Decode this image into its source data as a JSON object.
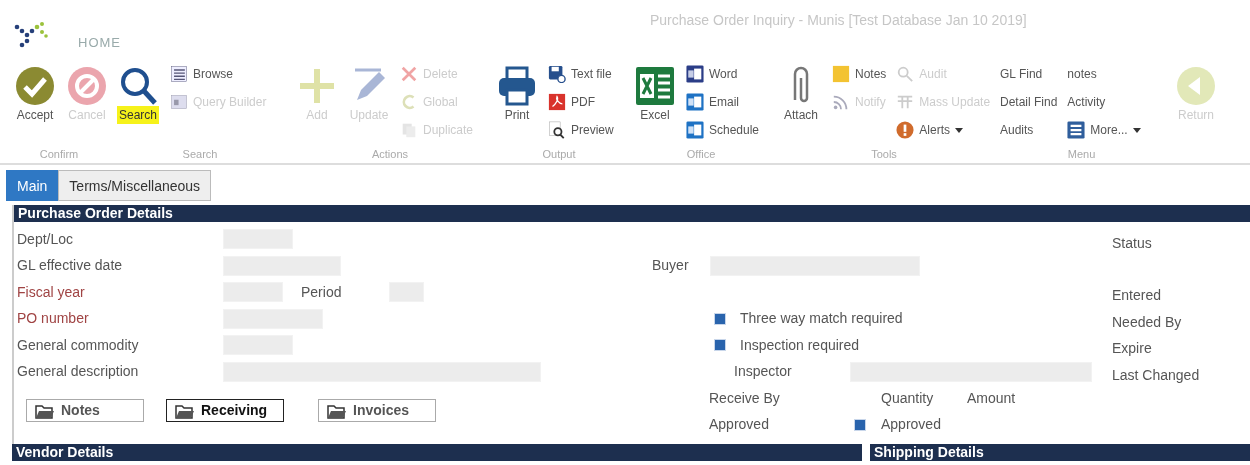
{
  "window": {
    "title": "Purchase Order Inquiry - Munis [Test Database Jan 10 2019]"
  },
  "ribbon": {
    "tab": "HOME",
    "groups": [
      {
        "label": "Confirm",
        "columns": [
          {
            "kind": "large",
            "items": [
              {
                "label": "Accept",
                "disabled": false
              }
            ]
          },
          {
            "kind": "large",
            "items": [
              {
                "label": "Cancel",
                "disabled": true
              }
            ]
          }
        ]
      },
      {
        "label": "Search",
        "columns": [
          {
            "kind": "large",
            "items": [
              {
                "label": "Search",
                "disabled": false,
                "highlighted": true
              }
            ]
          },
          {
            "kind": "small",
            "items": [
              {
                "label": "Browse",
                "disabled": false
              },
              {
                "label": "Query Builder",
                "disabled": true
              }
            ]
          }
        ]
      },
      {
        "label": "Actions",
        "columns": [
          {
            "kind": "large",
            "items": [
              {
                "label": "Add",
                "disabled": true
              }
            ]
          },
          {
            "kind": "large",
            "items": [
              {
                "label": "Update",
                "disabled": true
              }
            ]
          },
          {
            "kind": "small",
            "items": [
              {
                "label": "Delete",
                "disabled": true
              },
              {
                "label": "Global",
                "disabled": true
              },
              {
                "label": "Duplicate",
                "disabled": true
              }
            ]
          }
        ]
      },
      {
        "label": "Output",
        "columns": [
          {
            "kind": "large",
            "items": [
              {
                "label": "Print",
                "disabled": false
              }
            ]
          },
          {
            "kind": "small",
            "items": [
              {
                "label": "Text file",
                "disabled": false
              },
              {
                "label": "PDF",
                "disabled": false
              },
              {
                "label": "Preview",
                "disabled": false
              }
            ]
          }
        ]
      },
      {
        "label": "Office",
        "columns": [
          {
            "kind": "large",
            "items": [
              {
                "label": "Excel",
                "disabled": false
              }
            ]
          },
          {
            "kind": "small",
            "items": [
              {
                "label": "Word",
                "disabled": false
              },
              {
                "label": "Email",
                "disabled": false
              },
              {
                "label": "Schedule",
                "disabled": false
              }
            ]
          }
        ]
      },
      {
        "label": "Tools",
        "columns": [
          {
            "kind": "large",
            "items": [
              {
                "label": "Attach",
                "disabled": false
              }
            ]
          },
          {
            "kind": "small",
            "items": [
              {
                "label": "Notes",
                "disabled": false
              },
              {
                "label": "Notify",
                "disabled": true
              }
            ]
          },
          {
            "kind": "small",
            "items": [
              {
                "label": "Audit",
                "disabled": true
              },
              {
                "label": "Mass Update",
                "disabled": true
              },
              {
                "label": "Alerts",
                "disabled": false,
                "menu": true
              }
            ]
          }
        ]
      },
      {
        "label": "Menu",
        "columns": [
          {
            "kind": "small",
            "items": [
              {
                "label": "GL Find",
                "disabled": false
              },
              {
                "label": "Detail Find",
                "disabled": false
              },
              {
                "label": "Audits",
                "disabled": false
              }
            ]
          },
          {
            "kind": "small",
            "items": [
              {
                "label": "notes",
                "disabled": false
              },
              {
                "label": "Activity",
                "disabled": false
              },
              {
                "label": "More...",
                "disabled": false,
                "menu": true
              }
            ]
          }
        ]
      },
      {
        "columns": [
          {
            "kind": "large",
            "items": [
              {
                "label": "Return",
                "disabled": true
              }
            ]
          }
        ]
      }
    ]
  },
  "tabs": [
    {
      "label": "Main",
      "selected": true
    },
    {
      "label": "Terms/Miscellaneous",
      "selected": false
    }
  ],
  "po_details": {
    "title": "Purchase Order Details",
    "left_fields": [
      {
        "label": "Dept/Loc",
        "required": false
      },
      {
        "label": "GL effective date",
        "required": false
      },
      {
        "label": "Fiscal year",
        "required": true,
        "extra_label": "Period"
      },
      {
        "label": "PO number",
        "required": true
      },
      {
        "label": "General commodity",
        "required": false
      },
      {
        "label": "General description",
        "required": false
      }
    ],
    "buttons": [
      {
        "label": "Notes",
        "active": false
      },
      {
        "label": "Receiving",
        "active": true
      },
      {
        "label": "Invoices",
        "active": false
      }
    ],
    "buyer_label": "Buyer",
    "checkboxes": [
      {
        "label": "Three way match required",
        "checked": true
      },
      {
        "label": "Inspection required",
        "checked": true
      }
    ],
    "inspector_label": "Inspector",
    "receive_by": {
      "label": "Receive By",
      "options": [
        "Quantity",
        "Amount"
      ]
    },
    "approved": {
      "label": "Approved",
      "checkbox_label": "Approved",
      "checked": true
    },
    "right_labels": [
      "Status",
      "Entered",
      "Needed By",
      "Expire",
      "Last Changed"
    ]
  },
  "sections": [
    "Vendor Details",
    "Shipping Details"
  ]
}
